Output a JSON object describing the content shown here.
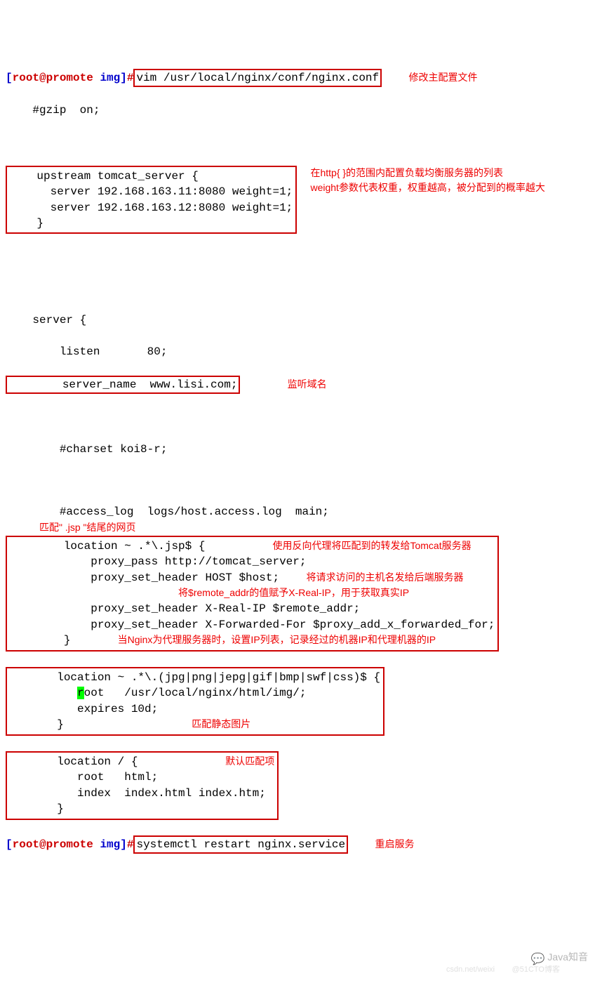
{
  "prompt1": {
    "bracket_open": "[",
    "user": "root@promote",
    "dir": "img",
    "bracket_close": "]",
    "hash": "#",
    "command": "vim /usr/local/nginx/conf/nginx.conf"
  },
  "annotations": {
    "modify_main_config": "修改主配置文件",
    "http_scope": "在http{ }的范围内配置负载均衡服务器的列表\nweight参数代表权重，权重越高，被分配到的概率越大",
    "listen_domain": "监听域名",
    "match_jsp": "匹配\" .jsp \"结尾的网页",
    "reverse_proxy": "使用反向代理将匹配到的转发给Tomcat服务器",
    "send_hostname": "将请求访问的主机名发给后端服务器",
    "remote_addr": "将$remote_addr的值赋予X-Real-IP，用于获取真实IP",
    "nginx_proxy_ip": "当Nginx为代理服务器时，设置IP列表，记录经过的机器IP和代理机器的IP",
    "match_static": "匹配静态图片",
    "default_match": "默认匹配项",
    "restart_service": "重启服务"
  },
  "config": {
    "gzip": "    #gzip  on;",
    "upstream1": "    upstream tomcat_server {",
    "upstream2": "      server 192.168.163.11:8080 weight=1;",
    "upstream3": "      server 192.168.163.12:8080 weight=1;",
    "upstream4": "    }",
    "server_open": "    server {",
    "listen": "        listen       80;",
    "server_name": "        server_name  www.lisi.com;",
    "charset": "        #charset koi8-r;",
    "access_log": "        #access_log  logs/host.access.log  main;",
    "loc_jsp1": "        location ~ .*\\.jsp$ {",
    "loc_jsp2": "            proxy_pass http://tomcat_server;",
    "loc_jsp3": "            proxy_set_header HOST $host;",
    "loc_jsp4": "            proxy_set_header X-Real-IP $remote_addr;",
    "loc_jsp5": "            proxy_set_header X-Forwarded-For $proxy_add_x_forwarded_for;",
    "loc_jsp6": "        }",
    "loc_img1": "       location ~ .*\\.(jpg|png|jepg|gif|bmp|swf|css)$ {",
    "loc_img2_a": "          ",
    "loc_img2_r": "r",
    "loc_img2_b": "oot   /usr/local/nginx/html/img/;",
    "loc_img3": "          expires 10d;",
    "loc_img4": "       }",
    "loc_def1": "       location / {",
    "loc_def2": "          root   html;",
    "loc_def3": "          index  index.html index.htm;",
    "loc_def4": "       }"
  },
  "prompt2": {
    "bracket_open": "[",
    "user": "root@promote",
    "dir": "img",
    "bracket_close": "]",
    "hash": "#",
    "command": "systemctl restart nginx.service"
  },
  "watermark_text": "Java知音",
  "watermark_sub": "csdn.net/weixi        @51CTO博客"
}
